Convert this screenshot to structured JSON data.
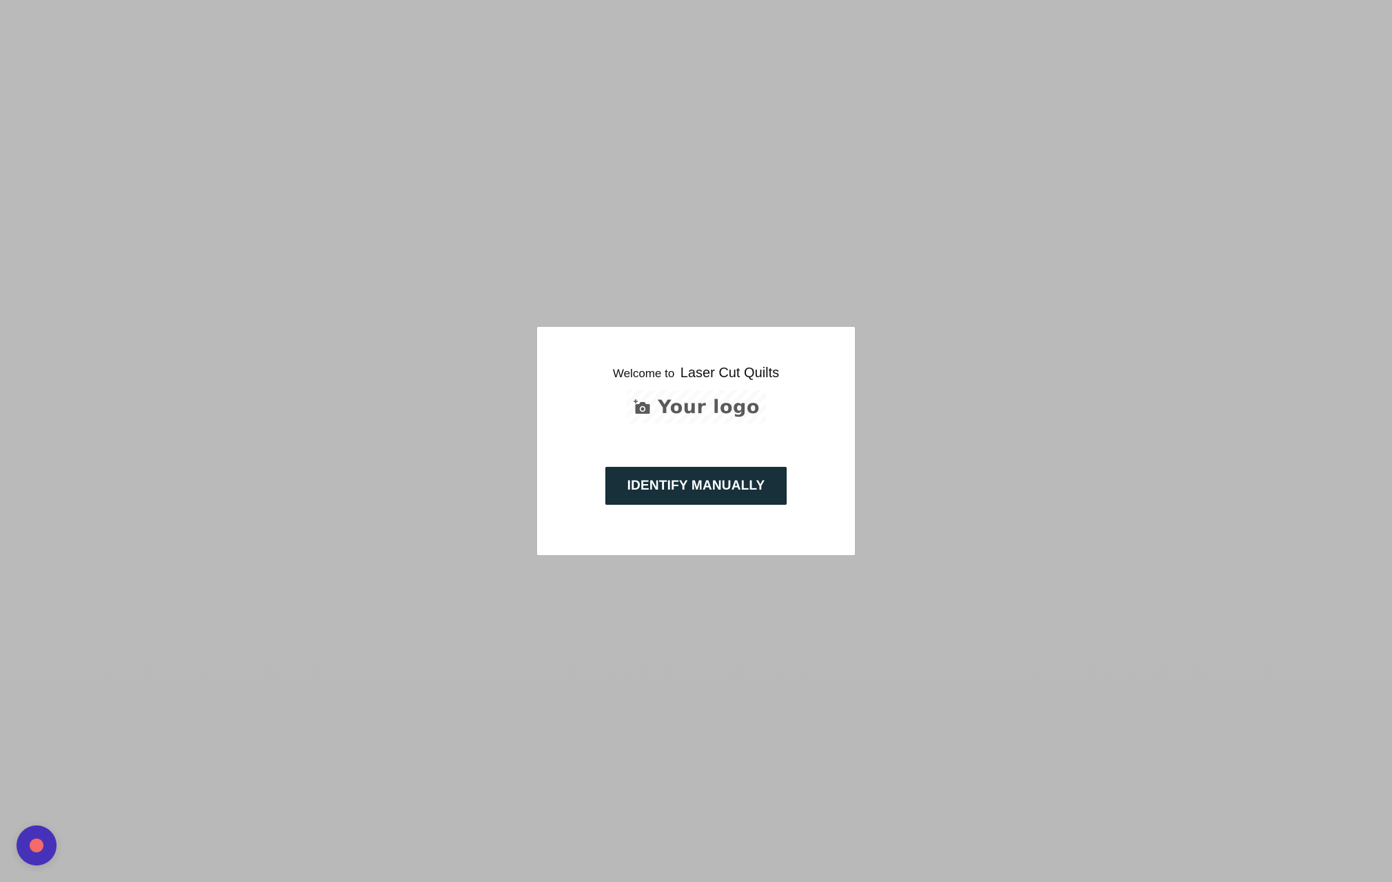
{
  "modal": {
    "welcome_prefix": "Welcome to",
    "shop_name": "Laser Cut Quilts",
    "logo_placeholder": "Your logo",
    "logo_icon": "camera-add-icon",
    "identify_button_label": "IDENTIFY MANUALLY"
  },
  "floating_action": {
    "icon": "record-icon"
  },
  "colors": {
    "backdrop": "#b9b9b9",
    "modal_background": "#ffffff",
    "button_background": "#17303a",
    "button_text": "#ffffff",
    "record_button": "#4632b8",
    "record_dot": "#f56a6a"
  }
}
